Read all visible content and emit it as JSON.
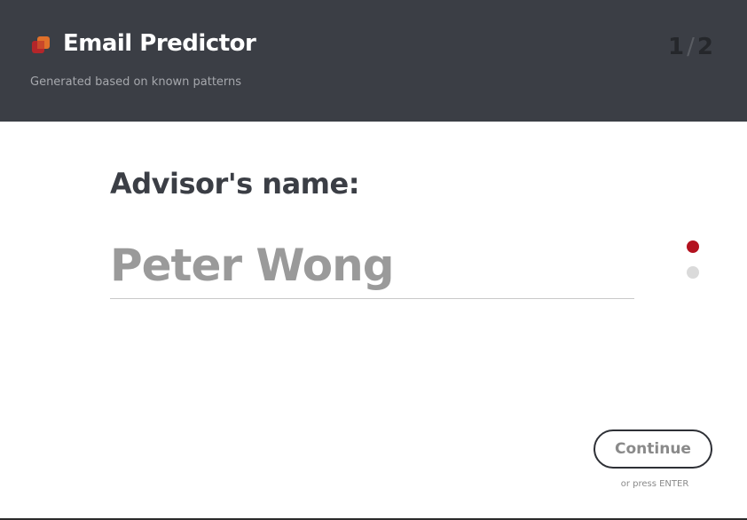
{
  "header": {
    "title": "Email Predictor",
    "subtitle": "Generated based on known patterns",
    "logo_icon": "layered-squares-logo-icon",
    "step": {
      "current": "1",
      "separator": "/",
      "total": "2"
    }
  },
  "form": {
    "question_label": "Advisor's name:",
    "name_input_value": "Peter Wong",
    "progress_dots": [
      {
        "state": "active"
      },
      {
        "state": "inactive"
      }
    ],
    "continue_label": "Continue",
    "enter_hint": "or press ENTER"
  },
  "colors": {
    "header_background": "#3b3e45",
    "accent": "#b3121f",
    "logo_front": "#e0702a",
    "logo_back": "#b4262a"
  }
}
